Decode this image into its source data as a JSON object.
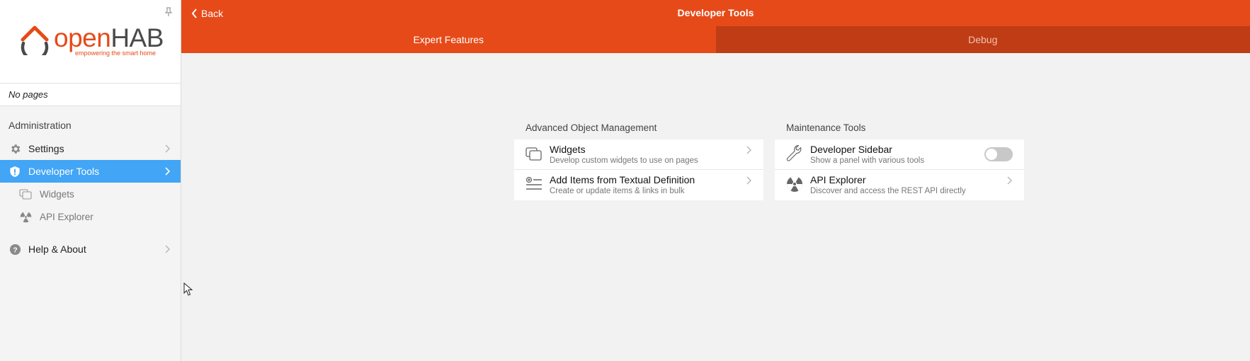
{
  "sidebar": {
    "logo": {
      "open": "open",
      "hab": "HAB",
      "tagline": "empowering the smart home"
    },
    "no_pages": "No pages",
    "section_title": "Administration",
    "items": [
      {
        "label": "Settings",
        "icon": "gear-icon"
      },
      {
        "label": "Developer Tools",
        "icon": "shield-icon",
        "active": true
      },
      {
        "label": "Widgets",
        "icon": "widgets-icon",
        "sub": true
      },
      {
        "label": "API Explorer",
        "icon": "radiation-icon",
        "sub": true
      },
      {
        "label": "Help & About",
        "icon": "help-icon"
      }
    ]
  },
  "topbar": {
    "back_label": "Back",
    "title": "Developer Tools",
    "tabs": [
      {
        "label": "Expert Features",
        "active": true
      },
      {
        "label": "Debug",
        "active": false
      }
    ]
  },
  "main": {
    "advanced": {
      "title": "Advanced Object Management",
      "rows": [
        {
          "title": "Widgets",
          "subtitle": "Develop custom widgets to use on pages",
          "icon": "widgets-icon"
        },
        {
          "title": "Add Items from Textual Definition",
          "subtitle": "Create or update items & links in bulk",
          "icon": "list-add-icon"
        }
      ]
    },
    "maintenance": {
      "title": "Maintenance Tools",
      "rows": [
        {
          "title": "Developer Sidebar",
          "subtitle": "Show a panel with various tools",
          "icon": "wrench-icon",
          "toggle": false
        },
        {
          "title": "API Explorer",
          "subtitle": "Discover and access the REST API directly",
          "icon": "radiation-icon"
        }
      ]
    }
  },
  "colors": {
    "accent": "#e64a19",
    "accent_dark": "#bf3c15",
    "active_nav": "#42a5f5",
    "background": "#f2f2f2"
  }
}
